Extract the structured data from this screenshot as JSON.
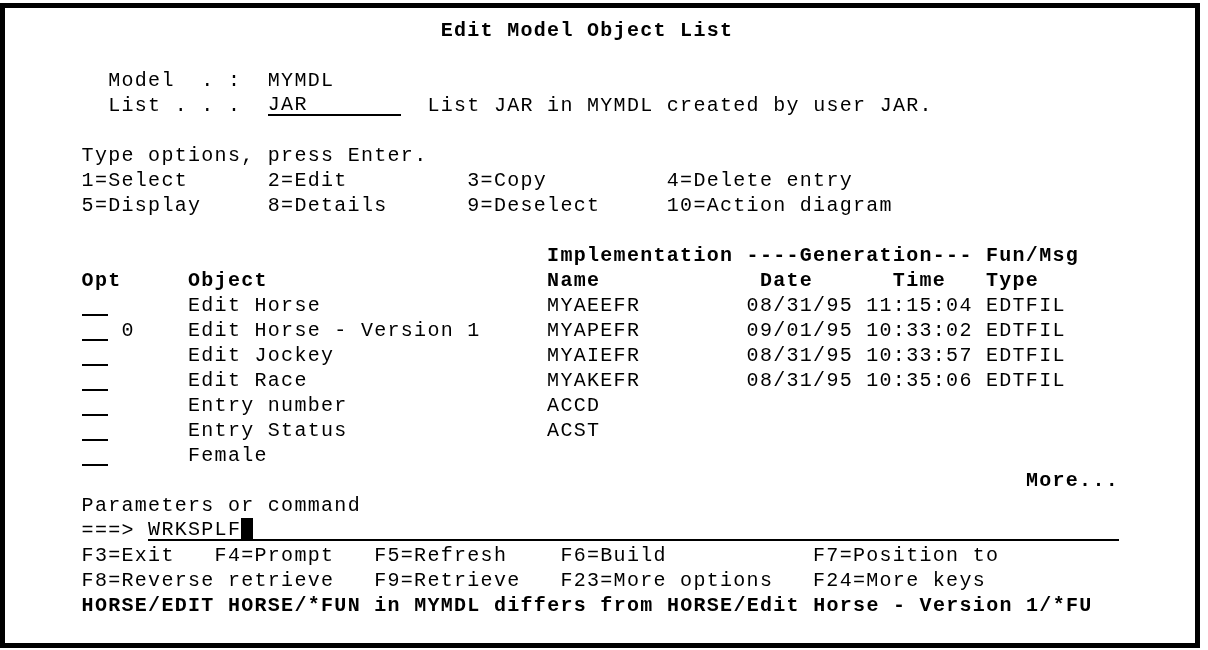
{
  "screen": {
    "title": "Edit Model Object List",
    "header_fields": [
      {
        "kind": "output",
        "label": "Model  . :",
        "value": "MYMDL"
      },
      {
        "kind": "input",
        "label": "List . . .",
        "value": "JAR",
        "description": "List JAR in MYMDL created by user JAR."
      }
    ],
    "instructions": "Type options, press Enter.",
    "options": [
      "1=Select",
      "2=Edit",
      "3=Copy",
      "4=Delete entry",
      "5=Display",
      "8=Details",
      "9=Deselect",
      "10=Action diagram"
    ],
    "table": {
      "heading_line_1": [
        "Implementation",
        "----Generation---",
        "Fun/Msg"
      ],
      "columns": [
        "Opt",
        "Object",
        "Name",
        "Date",
        "Time",
        "Type"
      ],
      "rows": [
        {
          "object": "Edit Horse",
          "name": "MYAEEFR",
          "date": "08/31/95",
          "time": "11:15:04",
          "type": "EDTFIL"
        },
        {
          "flag": "0",
          "object": "Edit Horse - Version 1",
          "name": "MYAPEFR",
          "date": "09/01/95",
          "time": "10:33:02",
          "type": "EDTFIL"
        },
        {
          "object": "Edit Jockey",
          "name": "MYAIEFR",
          "date": "08/31/95",
          "time": "10:33:57",
          "type": "EDTFIL"
        },
        {
          "object": "Edit Race",
          "name": "MYAKEFR",
          "date": "08/31/95",
          "time": "10:35:06",
          "type": "EDTFIL"
        },
        {
          "object": "Entry number",
          "name": "ACCD"
        },
        {
          "object": "Entry Status",
          "name": "ACST"
        },
        {
          "object": "Female"
        }
      ]
    },
    "more_indicator": "More...",
    "command": {
      "label": "Parameters or command",
      "prompt": "===>",
      "value": "WRKSPLF"
    },
    "function_keys": [
      [
        "F3=Exit",
        "F4=Prompt",
        "F5=Refresh",
        "F6=Build",
        "F7=Position to"
      ],
      [
        "F8=Reverse retrieve",
        "F9=Retrieve",
        "F23=More options",
        "F24=More keys"
      ]
    ],
    "message": "HORSE/EDIT HORSE/*FUN in MYMDL differs from HORSE/Edit Horse - Version 1/*FU"
  }
}
